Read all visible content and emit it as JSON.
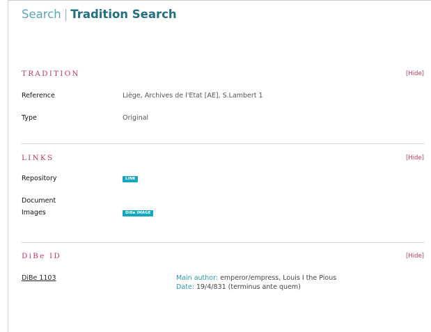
{
  "header": {
    "breadcrumb": "Search",
    "separator": "|",
    "current": "Tradition Search"
  },
  "tradition": {
    "title": "TRADITION",
    "hide": "[Hide]",
    "rows": [
      {
        "label": "Reference",
        "value": "Liège, Archives de l'Etat [AE], S.Lambert 1"
      },
      {
        "label": "Type",
        "value": "Original"
      }
    ]
  },
  "links": {
    "title": "LINKS",
    "hide": "[Hide]",
    "repository_label": "Repository",
    "repository_badge": "LINK",
    "document_label": "Document",
    "images_label": "Images",
    "images_badge": "DiBe IMAGE"
  },
  "dibe": {
    "title": "DiBe ID",
    "hide": "[Hide]",
    "id_link": "DiBe 1103",
    "main_author_key": "Main author:",
    "main_author_value": "emperor/empress, Louis I the Pious",
    "date_key": "Date:",
    "date_value": "19/4/831 (terminus ante quem)"
  },
  "colors": {
    "accent_red": "#c0395a",
    "teal": "#236f82",
    "badge": "#12a7bf"
  }
}
